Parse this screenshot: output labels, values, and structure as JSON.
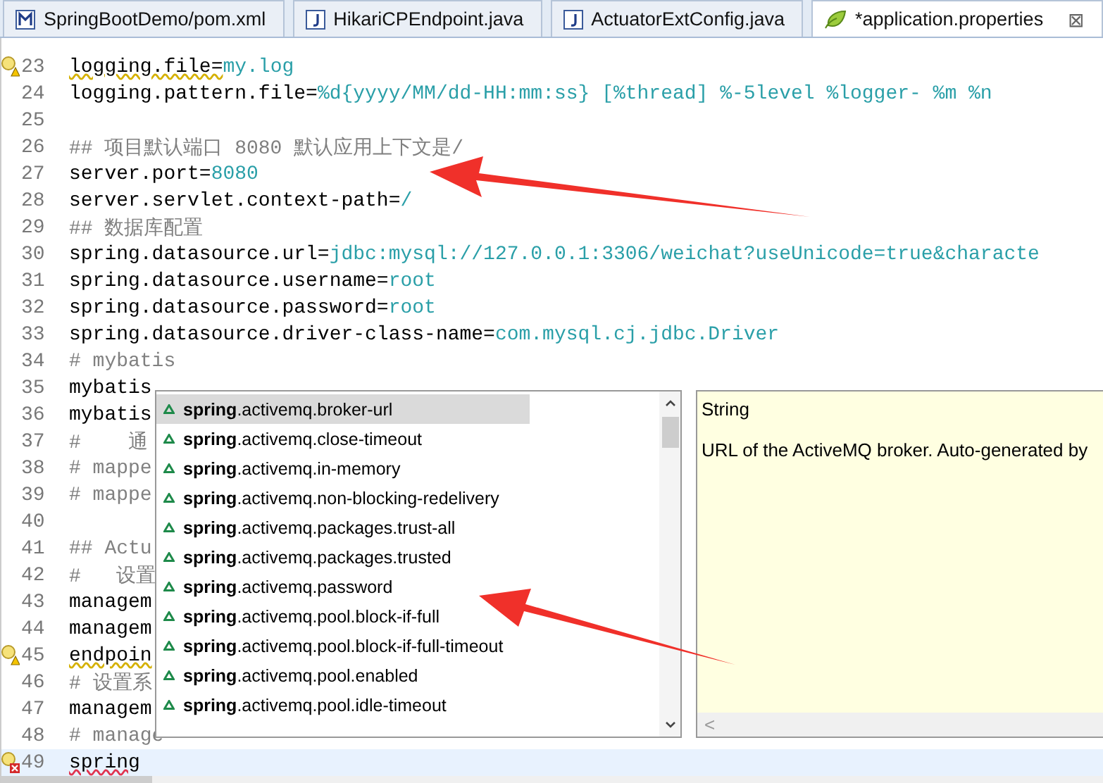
{
  "tabs": [
    {
      "label": "SpringBootDemo/pom.xml",
      "kind": "maven",
      "selected": false
    },
    {
      "label": "HikariCPEndpoint.java",
      "kind": "java",
      "selected": false
    },
    {
      "label": "ActuatorExtConfig.java",
      "kind": "java",
      "selected": false
    },
    {
      "label": "*application.properties",
      "kind": "properties",
      "selected": true,
      "close": "⊠"
    }
  ],
  "editor": {
    "lines": [
      {
        "number": "23",
        "kind": "property",
        "key": "logging.file=",
        "value": "my.log",
        "warning": true
      },
      {
        "number": "24",
        "kind": "property",
        "key": "logging.pattern.file=",
        "value": "%d{yyyy/MM/dd-HH:mm:ss} [%thread] %-5level %logger- %m %n"
      },
      {
        "number": "25",
        "kind": "blank"
      },
      {
        "number": "26",
        "kind": "comment",
        "text": "## 项目默认端口 8080 默认应用上下文是/"
      },
      {
        "number": "27",
        "kind": "property",
        "key": "server.port=",
        "value": "8080"
      },
      {
        "number": "28",
        "kind": "property",
        "key": "server.servlet.context-path=",
        "value": "/"
      },
      {
        "number": "29",
        "kind": "comment",
        "text": "## 数据库配置"
      },
      {
        "number": "30",
        "kind": "property",
        "key": "spring.datasource.url=",
        "value": "jdbc:mysql://127.0.0.1:3306/weichat?useUnicode=true&characte"
      },
      {
        "number": "31",
        "kind": "property",
        "key": "spring.datasource.username=",
        "value": "root"
      },
      {
        "number": "32",
        "kind": "property",
        "key": "spring.datasource.password=",
        "value": "root"
      },
      {
        "number": "33",
        "kind": "property",
        "key": "spring.datasource.driver-class-name=",
        "value": "com.mysql.cj.jdbc.Driver"
      },
      {
        "number": "34",
        "kind": "comment",
        "text": "# mybatis"
      },
      {
        "number": "35",
        "kind": "property",
        "key": "mybatis"
      },
      {
        "number": "36",
        "kind": "property",
        "key": "mybatis"
      },
      {
        "number": "37",
        "kind": "comment",
        "text": "#    通"
      },
      {
        "number": "38",
        "kind": "comment",
        "text": "# mappe"
      },
      {
        "number": "39",
        "kind": "comment",
        "text": "# mappe"
      },
      {
        "number": "40",
        "kind": "blank"
      },
      {
        "number": "41",
        "kind": "comment",
        "text": "## Actu"
      },
      {
        "number": "42",
        "kind": "comment",
        "text": "#   设置"
      },
      {
        "number": "43",
        "kind": "property",
        "key": "managem"
      },
      {
        "number": "44",
        "kind": "property",
        "key": "managem"
      },
      {
        "number": "45",
        "kind": "property",
        "key": "endpoin",
        "warning": true
      },
      {
        "number": "46",
        "kind": "comment",
        "text": "# 设置系"
      },
      {
        "number": "47",
        "kind": "property",
        "key": "managem"
      },
      {
        "number": "48",
        "kind": "comment",
        "text": "# manage"
      },
      {
        "number": "49",
        "kind": "property",
        "key": "spring",
        "error": true,
        "current": true
      }
    ]
  },
  "completion": {
    "items": [
      {
        "label": "**spring**.activemq.broker-url",
        "selected": true
      },
      {
        "label": "**spring**.activemq.close-timeout",
        "selected": false
      },
      {
        "label": "**spring**.activemq.in-memory",
        "selected": false
      },
      {
        "label": "**spring**.activemq.non-blocking-redelivery",
        "selected": false
      },
      {
        "label": "**spring**.activemq.packages.trust-all",
        "selected": false
      },
      {
        "label": "**spring**.activemq.packages.trusted",
        "selected": false
      },
      {
        "label": "**spring**.activemq.password",
        "selected": false
      },
      {
        "label": "**spring**.activemq.pool.block-if-full",
        "selected": false
      },
      {
        "label": "**spring**.activemq.pool.block-if-full-timeout",
        "selected": false
      },
      {
        "label": "**spring**.activemq.pool.enabled",
        "selected": false
      },
      {
        "label": "**spring**.activemq.pool.idle-timeout",
        "selected": false
      }
    ]
  },
  "info": {
    "type": "String",
    "description": "URL of the ActiveMQ broker. Auto-generated by",
    "scroll_left": "<"
  }
}
